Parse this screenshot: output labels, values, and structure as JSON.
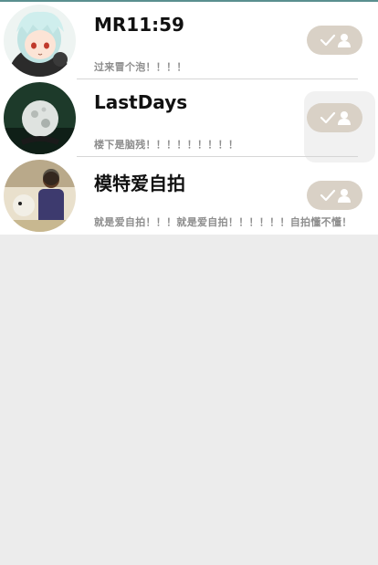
{
  "colors": {
    "accent_line": "#5a8f8f",
    "background": "#ececec",
    "button_bg": "#d9d1c6",
    "name_text": "#111111",
    "message_text": "#8e8e8e"
  },
  "contacts": [
    {
      "name": "MR11:59",
      "message": "过来冒个泡！！！！",
      "avatar_icon": "anime-boy-avatar",
      "action_icon": "check-person-icon"
    },
    {
      "name": "LastDays",
      "message": "楼下是脑残！！！！！！！！！",
      "avatar_icon": "moon-photo-avatar",
      "action_icon": "check-person-icon"
    },
    {
      "name": "模特爱自拍",
      "message": "就是爱自拍！！！就是爱自拍！！！！！！自拍懂不懂！",
      "avatar_icon": "selfie-photo-avatar",
      "action_icon": "check-person-icon"
    }
  ]
}
